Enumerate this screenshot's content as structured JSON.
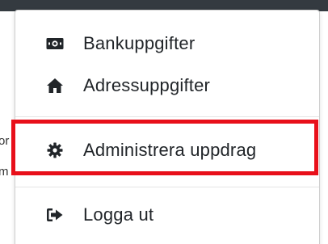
{
  "background": {
    "fragment_1": "or",
    "fragment_2": "m"
  },
  "menu": {
    "items": [
      {
        "label": "Bankuppgifter",
        "icon": "money-bill-icon"
      },
      {
        "label": "Adressuppgifter",
        "icon": "home-icon"
      },
      {
        "label": "Administrera uppdrag",
        "icon": "gear-icon"
      },
      {
        "label": "Logga ut",
        "icon": "sign-out-icon"
      }
    ]
  },
  "colors": {
    "highlight": "#e8101a",
    "icon": "#212529",
    "topbar": "#343a40"
  }
}
